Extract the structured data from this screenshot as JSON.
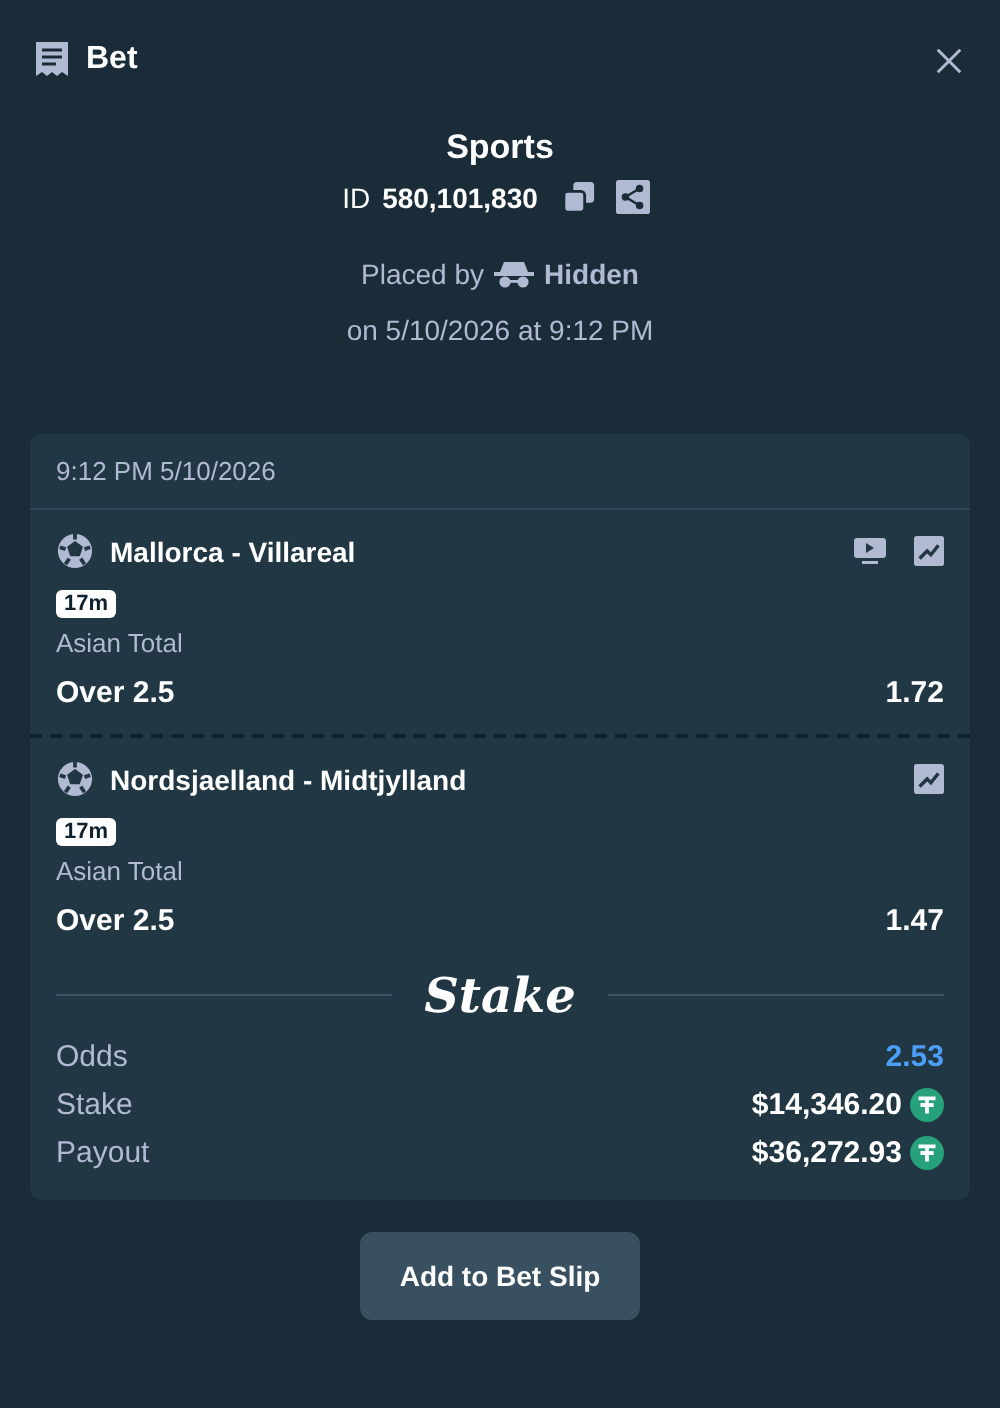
{
  "window": {
    "title": "Bet"
  },
  "header": {
    "category": "Sports",
    "id_label": "ID",
    "id_value": "580,101,830",
    "placed_by_label": "Placed by",
    "placed_by_user": "Hidden",
    "placed_on": "on 5/10/2026 at 9:12 PM"
  },
  "ticket": {
    "timestamp": "9:12 PM 5/10/2026",
    "events": [
      {
        "name": "Mallorca - Villareal",
        "stream": true,
        "badge": "17m",
        "market": "Asian Total",
        "outcome": "Over 2.5",
        "odds": "1.72"
      },
      {
        "name": "Nordsjaelland - Midtjylland",
        "stream": false,
        "badge": "17m",
        "market": "Asian Total",
        "outcome": "Over 2.5",
        "odds": "1.47"
      }
    ],
    "brand": "Stake",
    "summary": [
      {
        "kind": "odds",
        "label": "Odds",
        "value": "2.53"
      },
      {
        "kind": "amount",
        "label": "Stake",
        "value": "$14,346.20"
      },
      {
        "kind": "amount",
        "label": "Payout",
        "value": "$36,272.93"
      }
    ]
  },
  "buttons": [
    "Add to Bet Slip"
  ]
}
